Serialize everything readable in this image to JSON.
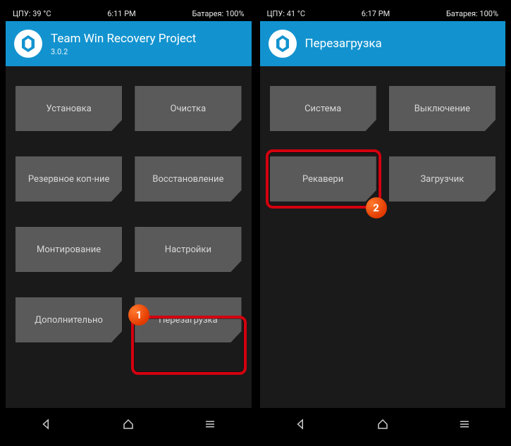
{
  "left": {
    "statusbar": {
      "cpu": "ЦПУ: 39 °C",
      "time": "6:11 PM",
      "battery": "Батарея: 100%"
    },
    "header": {
      "title": "Team Win Recovery Project",
      "sub": "3.0.2"
    },
    "tiles": {
      "install": "Установка",
      "wipe": "Очистка",
      "backup": "Резервное коп-ние",
      "restore": "Восстановление",
      "mount": "Монтирование",
      "settings": "Настройки",
      "advanced": "Дополнительно",
      "reboot": "Перезагрузка"
    },
    "callout": "1"
  },
  "right": {
    "statusbar": {
      "cpu": "ЦПУ: 41 °C",
      "time": "6:17 PM",
      "battery": "Батарея: 100%"
    },
    "header": {
      "title": "Перезагрузка",
      "sub": ""
    },
    "tiles": {
      "system": "Система",
      "poweroff": "Выключение",
      "recovery": "Рекавери",
      "bootloader": "Загрузчик"
    },
    "callout": "2"
  }
}
